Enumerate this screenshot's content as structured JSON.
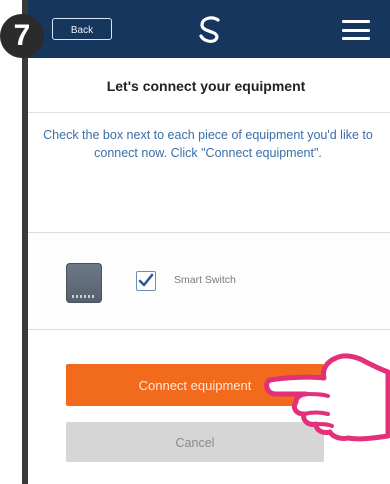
{
  "step": {
    "number": "7"
  },
  "header": {
    "back_label": "Back",
    "colors": {
      "bar": "#16365e"
    }
  },
  "main": {
    "title": "Let's connect your equipment",
    "instructions": "Check the box next to each piece of equipment you'd like to connect now. Click \"Connect equipment\".",
    "equipment": [
      {
        "label": "Smart Switch",
        "checked": true
      }
    ],
    "connect_label": "Connect equipment",
    "cancel_label": "Cancel"
  },
  "colors": {
    "accent": "#f26a1b",
    "cancel": "#d6d6d6",
    "link_text": "#3a6fa8"
  },
  "icons": [
    "logo-icon",
    "menu-icon",
    "device-icon",
    "check-icon",
    "pointing-hand-icon"
  ]
}
